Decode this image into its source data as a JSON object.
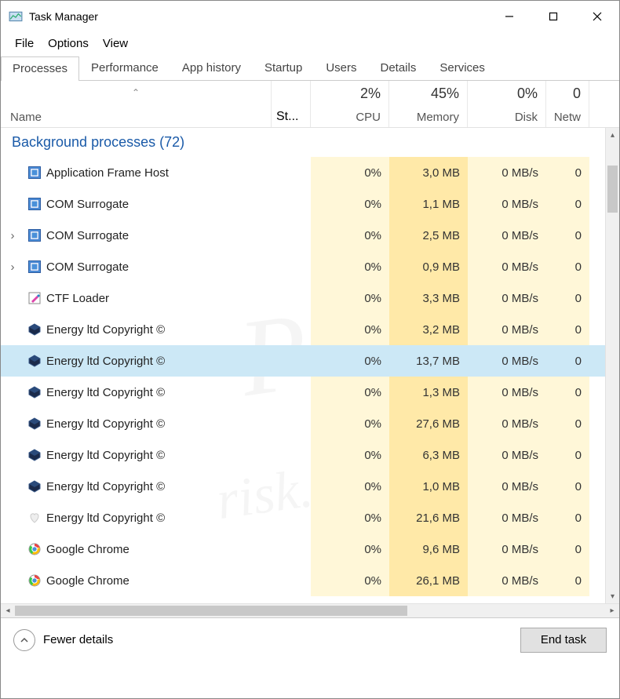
{
  "window": {
    "title": "Task Manager"
  },
  "menu": {
    "file": "File",
    "options": "Options",
    "view": "View"
  },
  "tabs": [
    "Processes",
    "Performance",
    "App history",
    "Startup",
    "Users",
    "Details",
    "Services"
  ],
  "active_tab": 0,
  "columns": {
    "name": "Name",
    "status": "St...",
    "cpu": {
      "pct": "2%",
      "label": "CPU"
    },
    "memory": {
      "pct": "45%",
      "label": "Memory"
    },
    "disk": {
      "pct": "0%",
      "label": "Disk"
    },
    "network": {
      "pct": "0",
      "label": "Netw"
    }
  },
  "section": "Background processes (72)",
  "rows": [
    {
      "expand": "",
      "icon": "app-blue",
      "name": "Application Frame Host",
      "cpu": "0%",
      "mem": "3,0 MB",
      "disk": "0 MB/s",
      "net": "0",
      "sel": false
    },
    {
      "expand": "",
      "icon": "app-blue",
      "name": "COM Surrogate",
      "cpu": "0%",
      "mem": "1,1 MB",
      "disk": "0 MB/s",
      "net": "0",
      "sel": false
    },
    {
      "expand": ">",
      "icon": "app-blue",
      "name": "COM Surrogate",
      "cpu": "0%",
      "mem": "2,5 MB",
      "disk": "0 MB/s",
      "net": "0",
      "sel": false
    },
    {
      "expand": ">",
      "icon": "app-blue",
      "name": "COM Surrogate",
      "cpu": "0%",
      "mem": "0,9 MB",
      "disk": "0 MB/s",
      "net": "0",
      "sel": false
    },
    {
      "expand": "",
      "icon": "pencil",
      "name": "CTF Loader",
      "cpu": "0%",
      "mem": "3,3 MB",
      "disk": "0 MB/s",
      "net": "0",
      "sel": false
    },
    {
      "expand": "",
      "icon": "hex",
      "name": "Energy ltd Copyright ©",
      "cpu": "0%",
      "mem": "3,2 MB",
      "disk": "0 MB/s",
      "net": "0",
      "sel": false
    },
    {
      "expand": "",
      "icon": "hex",
      "name": "Energy ltd Copyright ©",
      "cpu": "0%",
      "mem": "13,7 MB",
      "disk": "0 MB/s",
      "net": "0",
      "sel": true
    },
    {
      "expand": "",
      "icon": "hex",
      "name": "Energy ltd Copyright ©",
      "cpu": "0%",
      "mem": "1,3 MB",
      "disk": "0 MB/s",
      "net": "0",
      "sel": false
    },
    {
      "expand": "",
      "icon": "hex",
      "name": "Energy ltd Copyright ©",
      "cpu": "0%",
      "mem": "27,6 MB",
      "disk": "0 MB/s",
      "net": "0",
      "sel": false
    },
    {
      "expand": "",
      "icon": "hex",
      "name": "Energy ltd Copyright ©",
      "cpu": "0%",
      "mem": "6,3 MB",
      "disk": "0 MB/s",
      "net": "0",
      "sel": false
    },
    {
      "expand": "",
      "icon": "hex",
      "name": "Energy ltd Copyright ©",
      "cpu": "0%",
      "mem": "1,0 MB",
      "disk": "0 MB/s",
      "net": "0",
      "sel": false
    },
    {
      "expand": "",
      "icon": "heart",
      "name": "Energy ltd Copyright ©",
      "cpu": "0%",
      "mem": "21,6 MB",
      "disk": "0 MB/s",
      "net": "0",
      "sel": false
    },
    {
      "expand": "",
      "icon": "chrome",
      "name": "Google Chrome",
      "cpu": "0%",
      "mem": "9,6 MB",
      "disk": "0 MB/s",
      "net": "0",
      "sel": false
    },
    {
      "expand": "",
      "icon": "chrome",
      "name": "Google Chrome",
      "cpu": "0%",
      "mem": "26,1 MB",
      "disk": "0 MB/s",
      "net": "0",
      "sel": false
    }
  ],
  "footer": {
    "fewer": "Fewer details",
    "endtask": "End task"
  }
}
